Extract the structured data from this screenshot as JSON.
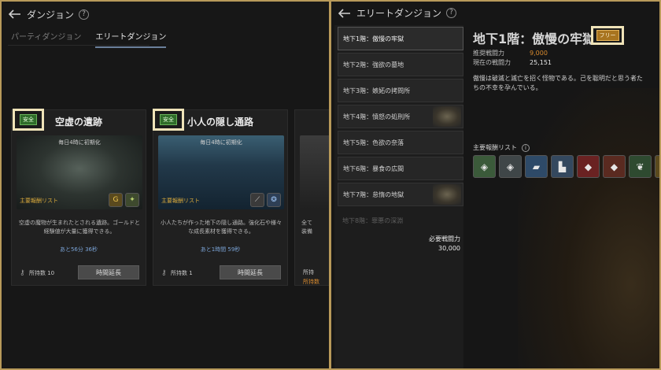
{
  "left": {
    "header_title": "ダンジョン",
    "tabs": [
      {
        "label": "パーティダンジョン",
        "active": false
      },
      {
        "label": "エリートダンジョン",
        "active": true
      }
    ],
    "cards": [
      {
        "title": "空虚の遺跡",
        "badge": "安全",
        "reset": "毎日4時に初期化",
        "reward_label": "主要報酬リスト",
        "desc": "空虚の魔物が生まれたとされる遺跡。ゴールドと経験値が大量に獲得できる。",
        "timer": "あと56分 36秒",
        "hold": "所持数 10",
        "button": "時間延長"
      },
      {
        "title": "小人の隠し通路",
        "badge": "安全",
        "reset": "毎日4時に初期化",
        "reward_label": "主要報酬リスト",
        "desc": "小人たちが作った地下の隠し通路。強化石や様々な成長素材を獲得できる。",
        "timer": "あと1時間 59秒",
        "hold": "所持数 1",
        "button": "時間延長"
      },
      {
        "desc_partial": "全て\n装備",
        "hold_partial": "所持",
        "hold_partial2": "所持数"
      }
    ]
  },
  "right": {
    "header_title": "エリートダンジョン",
    "floors": [
      {
        "label": "地下1階：傲慢の牢獄",
        "selected": true
      },
      {
        "label": "地下2階：強欲の墓地"
      },
      {
        "label": "地下3階：嫉妬の拷問所"
      },
      {
        "label": "地下4階：憤怒の処刑所",
        "thumb": true
      },
      {
        "label": "地下5階：色欲の奈落"
      },
      {
        "label": "地下6階：暴食の広間"
      },
      {
        "label": "地下7階：怠惰の地獄",
        "thumb": true
      },
      {
        "label": "地下8階：罪悪の深淵",
        "locked": true
      }
    ],
    "required_label": "必要戦闘力",
    "required_value": "30,000",
    "title": "地下1階：傲慢の牢獄",
    "badge": "フリー",
    "recommended_label": "推奨戦闘力",
    "recommended_value": "9,000",
    "current_label": "現在の戦闘力",
    "current_value": "25,151",
    "description": "傲慢は破滅と滅亡を招く怪物である。己を聡明だと思う者たちの不幸を孕んでいる。",
    "reward_label": "主要報酬リスト",
    "rewards": [
      {
        "icon": "gold-rune-icon",
        "glyph": "◈",
        "color": "#3b5a3a"
      },
      {
        "icon": "silver-rune-icon",
        "glyph": "◈",
        "color": "#3f4648"
      },
      {
        "icon": "blue-scroll-icon",
        "glyph": "▰",
        "color": "#2e4a68"
      },
      {
        "icon": "boots-icon",
        "glyph": "▙",
        "color": "#34485e"
      },
      {
        "icon": "red-gem-icon",
        "glyph": "◆",
        "color": "#6a2222"
      },
      {
        "icon": "red-ore-icon",
        "glyph": "◆",
        "color": "#5a2a20"
      },
      {
        "icon": "green-leaf-icon",
        "glyph": "❦",
        "color": "#2e4a30"
      },
      {
        "icon": "gold-leaf-icon",
        "glyph": "❦",
        "color": "#5a4a1e"
      }
    ]
  },
  "colors": {
    "highlight": "#efe3b8",
    "orange": "#d88a2e",
    "timer_blue": "#7aa3d6",
    "reward_gold": "#d8a93c"
  }
}
